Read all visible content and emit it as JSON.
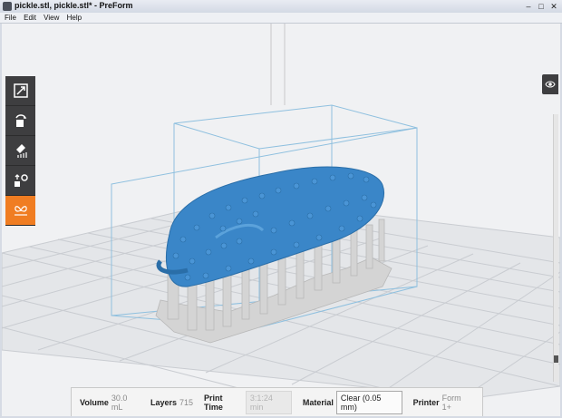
{
  "window": {
    "title": "pickle.stl, pickle.stl* - PreForm",
    "minimize": "–",
    "maximize": "□",
    "close": "✕"
  },
  "menu": [
    "File",
    "Edit",
    "View",
    "Help"
  ],
  "tools": [
    {
      "name": "scale-tool",
      "icon": "scale-icon"
    },
    {
      "name": "rotate-tool",
      "icon": "rotate-icon"
    },
    {
      "name": "supports-tool",
      "icon": "supports-icon"
    },
    {
      "name": "layout-tool",
      "icon": "layout-icon"
    },
    {
      "name": "print-tool",
      "icon": "butterfly-icon",
      "active": true
    }
  ],
  "view_button_icon": "view-eye-icon",
  "status": {
    "volume_label": "Volume",
    "volume_value": "30.0 mL",
    "layers_label": "Layers",
    "layers_value": "715",
    "print_time_label": "Print Time",
    "print_time_value": "3:1:24 min",
    "material_label": "Material",
    "material_value": "Clear (0.05 mm)",
    "printer_label": "Printer",
    "printer_value": "Form 1+"
  },
  "colors": {
    "accent": "#f07d22",
    "model": "#3a86c8",
    "support": "#d4d4d4",
    "toolbar": "#3e3e40"
  }
}
